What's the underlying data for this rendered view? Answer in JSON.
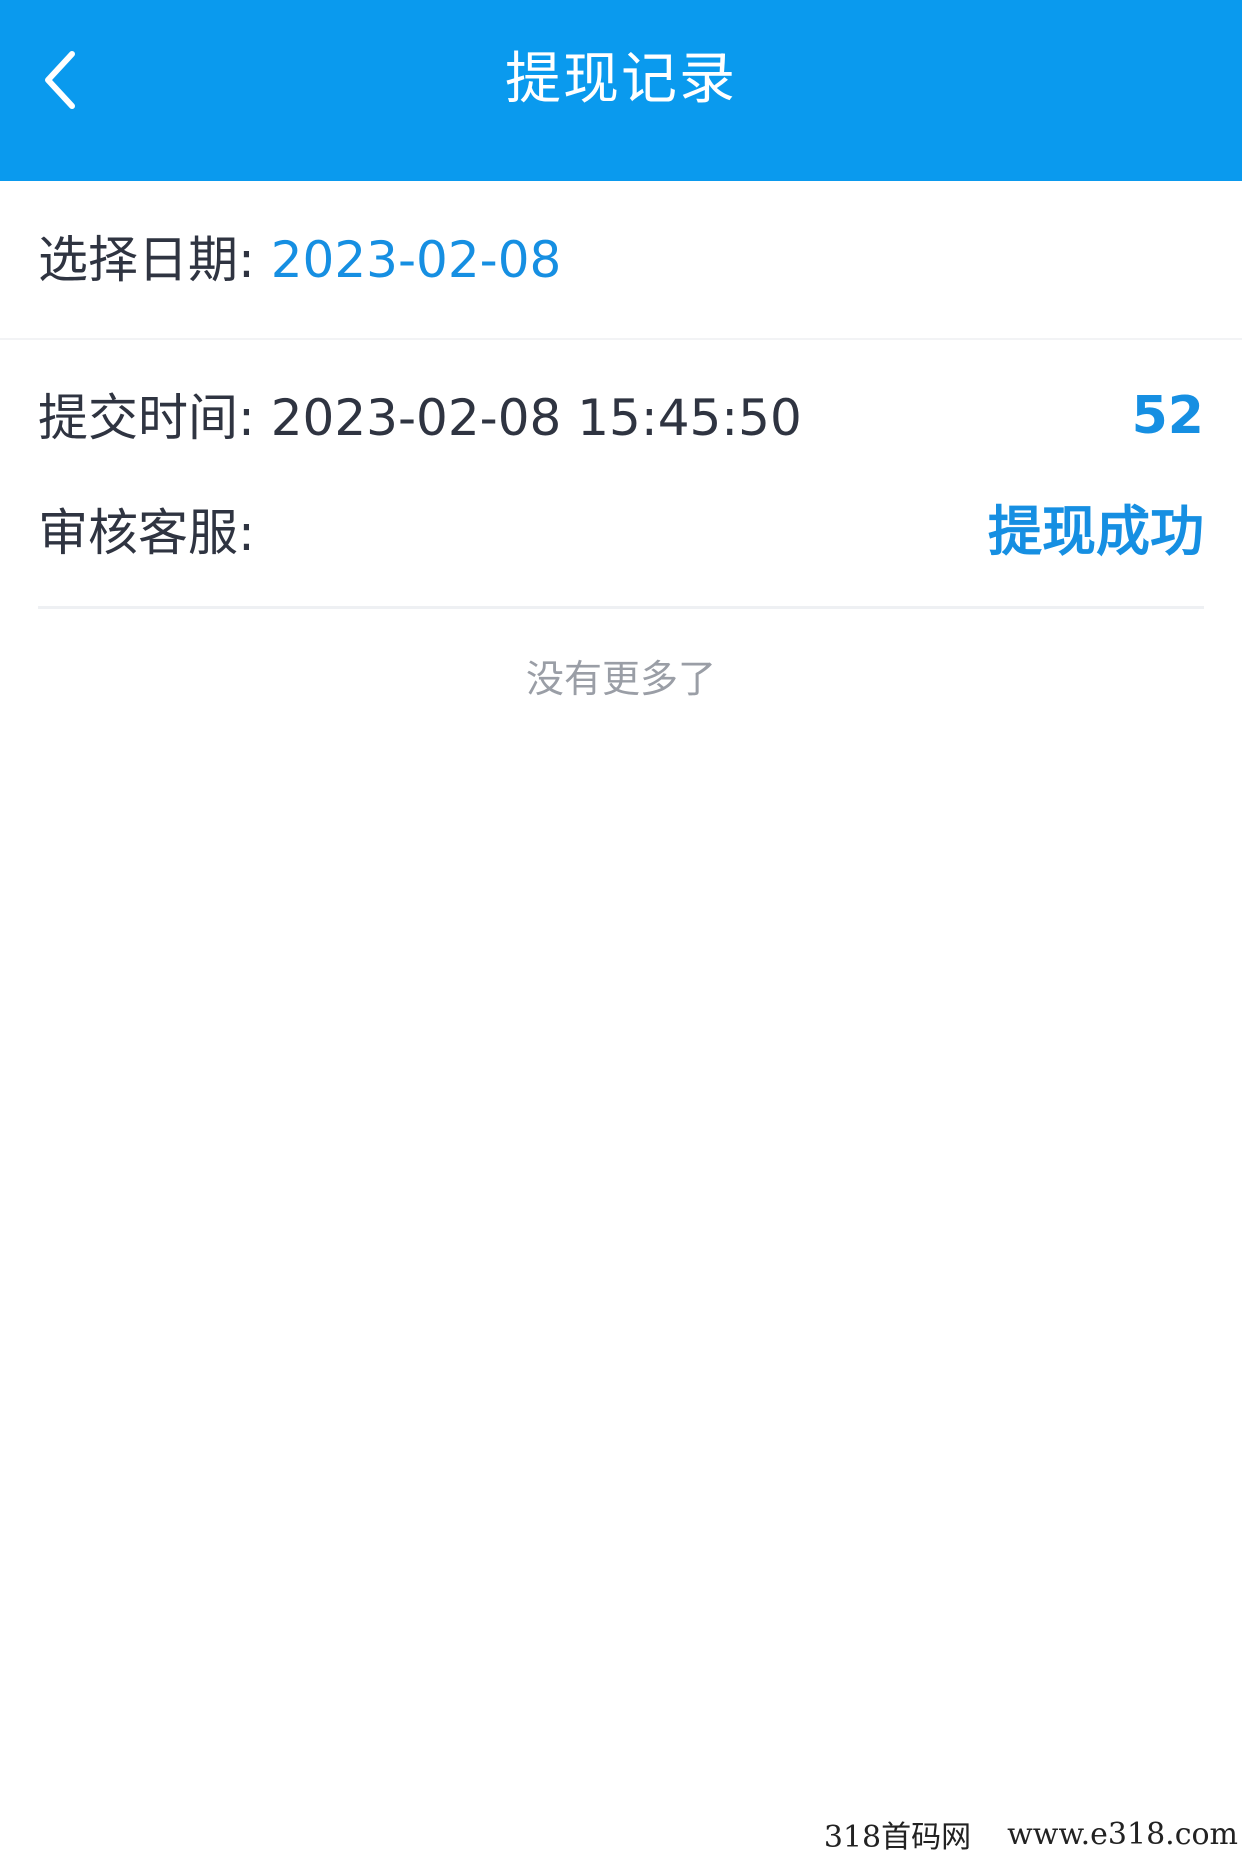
{
  "header": {
    "title": "提现记录",
    "back_icon": "chevron-left-icon",
    "bg_color": "#0a9aee"
  },
  "date_filter": {
    "label": "选择日期: ",
    "value": "2023-02-08"
  },
  "records": [
    {
      "submit_time_label": "提交时间: ",
      "submit_time": "2023-02-08 15:45:50",
      "amount": "52",
      "reviewer_label": "审核客服:",
      "status": "提现成功"
    }
  ],
  "list_end_text": "没有更多了",
  "watermark": {
    "site_name": "318首码网",
    "url": "www.e318.com"
  },
  "colors": {
    "accent": "#168fe2",
    "text": "#2f3441",
    "muted": "#9a9ea6"
  }
}
